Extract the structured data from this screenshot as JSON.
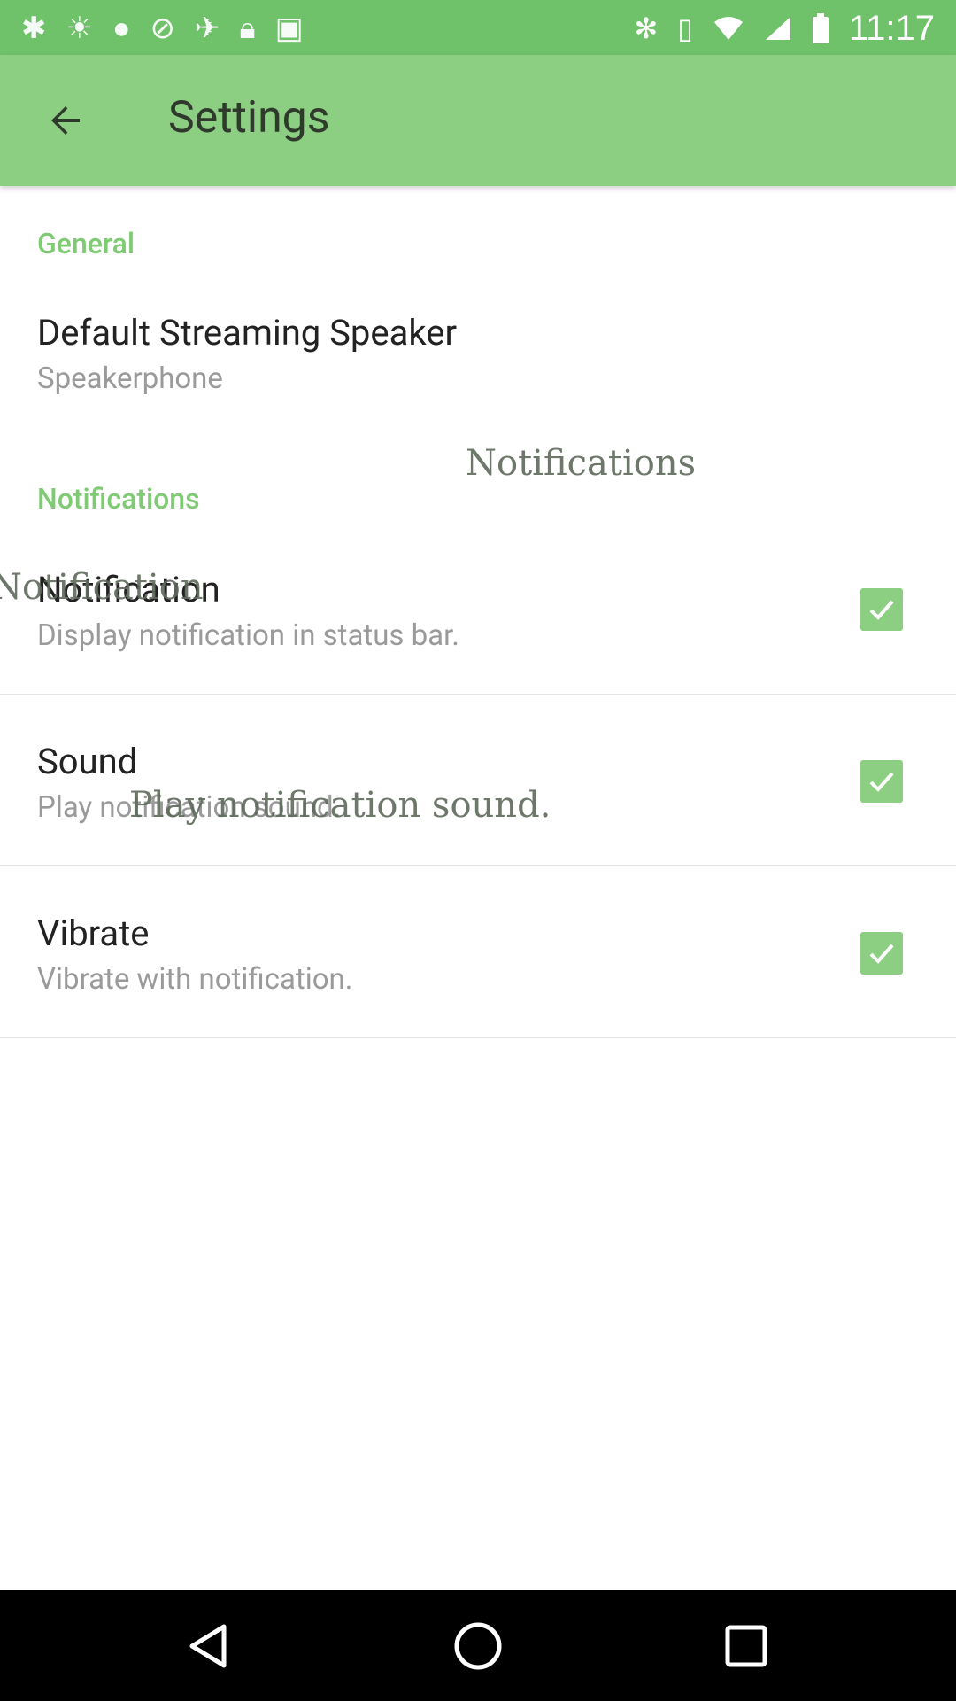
{
  "status_bar": {
    "left_icons": [
      "app-icon",
      "brightness-icon",
      "app-icon",
      "satellite-icon",
      "notification-dot-icon",
      "blocked-icon",
      "satellite-icon",
      "lock-icon",
      "android-icon"
    ],
    "right_icons": [
      "bluetooth-icon",
      "vibrate-icon",
      "wifi-icon",
      "signal-icon",
      "battery-icon"
    ],
    "time": "11:17"
  },
  "app_bar": {
    "title": "Settings",
    "background": "#8dcf82",
    "status_background": "#6fc26a"
  },
  "sections": {
    "general": {
      "header": "General",
      "default_speaker": {
        "title": "Default Streaming Speaker",
        "summary": "Speakerphone"
      }
    },
    "notifications": {
      "header": "Notifications",
      "notification": {
        "title": "Notification",
        "summary": "Display notification in status bar.",
        "checked": true
      },
      "sound": {
        "title": "Sound",
        "summary": "Play notification sound.",
        "checked": true
      },
      "vibrate": {
        "title": "Vibrate",
        "summary": "Vibrate with notification.",
        "checked": true
      }
    }
  },
  "overlay_ghost_text": {
    "notifications": "Notifications",
    "notification": "Notification",
    "sound_summary": "Play notification sound."
  },
  "accent_color": "#7fcb74"
}
